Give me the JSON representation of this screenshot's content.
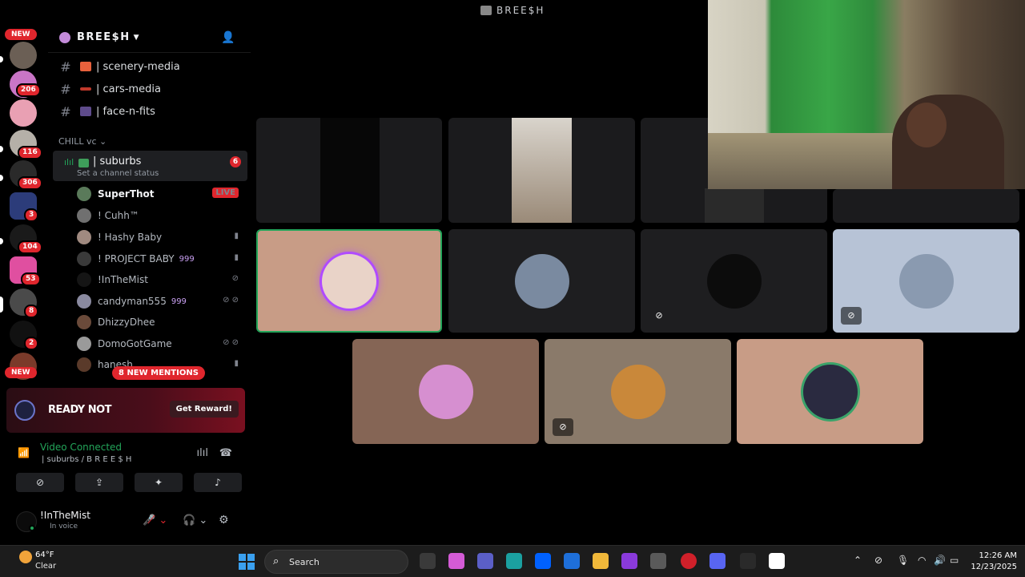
{
  "app": {
    "title": "BREE$H"
  },
  "rail": {
    "badges": [
      "206",
      "116",
      "306",
      "3",
      "104",
      "53",
      "8",
      "2"
    ],
    "new_top": "NEW",
    "new_bottom": "NEW"
  },
  "server": {
    "name": "BREE$H"
  },
  "channels": [
    {
      "name": "| scenery-media",
      "color": "#e8613c"
    },
    {
      "name": "| cars-media",
      "color": "#c0392b"
    },
    {
      "name": "| face-n-fits",
      "color": "#5e4b8b"
    }
  ],
  "category": "CHILL vc",
  "voice_channel": {
    "name": "| suburbs",
    "status": "Set a channel status",
    "count": "6"
  },
  "voice_users": [
    {
      "name": "SuperThot",
      "extra": "",
      "right": "LIVE"
    },
    {
      "name": "! Cuhh™",
      "extra": "",
      "right": ""
    },
    {
      "name": "! Hashy Baby",
      "extra": "",
      "right": "▮"
    },
    {
      "name": "! PROJECT BABY",
      "extra": "999",
      "right": "▮"
    },
    {
      "name": "!InTheMist",
      "extra": "",
      "right": "⊘"
    },
    {
      "name": "candyman555",
      "extra": "999",
      "right": "⊘ ⊘"
    },
    {
      "name": "DhizzyDhee",
      "extra": "",
      "right": ""
    },
    {
      "name": "DomoGotGame",
      "extra": "",
      "right": "⊘ ⊘"
    },
    {
      "name": "hanesh",
      "extra": "",
      "right": "▮"
    }
  ],
  "mentions": "8 NEW MENTIONS",
  "promo": {
    "name": "READY NOT",
    "button": "Get Reward!"
  },
  "voice_conn": {
    "status": "Video Connected",
    "sub": "| suburbs / B R E E $ H"
  },
  "user": {
    "name": "!InTheMist",
    "status": "In voice"
  },
  "taskbar": {
    "temp": "64°F",
    "condition": "Clear",
    "search": "Search",
    "time": "12:26 AM",
    "date": "12/23/2025"
  },
  "colors": {
    "accent_red": "#e0262d",
    "online_green": "#23a55a",
    "bg": "#000000"
  }
}
